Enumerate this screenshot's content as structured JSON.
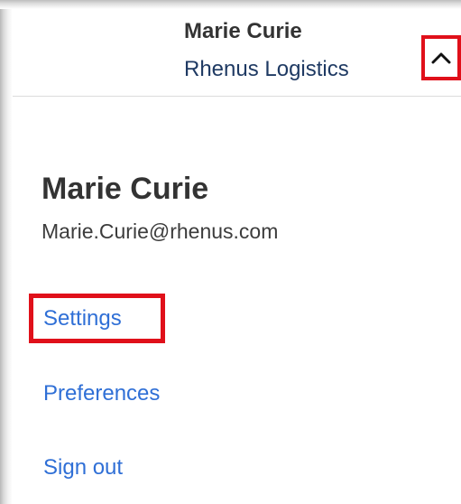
{
  "header": {
    "user_name": "Marie Curie",
    "company": "Rhenus Logistics",
    "toggle_icon": "chevron-up-icon"
  },
  "profile": {
    "name": "Marie Curie",
    "email": "Marie.Curie@rhenus.com"
  },
  "menu": {
    "items": [
      {
        "label": "Settings",
        "highlighted": true
      },
      {
        "label": "Preferences",
        "highlighted": false
      },
      {
        "label": "Sign out",
        "highlighted": false
      }
    ]
  },
  "colors": {
    "link": "#2f6fd6",
    "highlight_border": "#e0101a",
    "text_dark": "#333333",
    "company_text": "#1f3a63"
  }
}
